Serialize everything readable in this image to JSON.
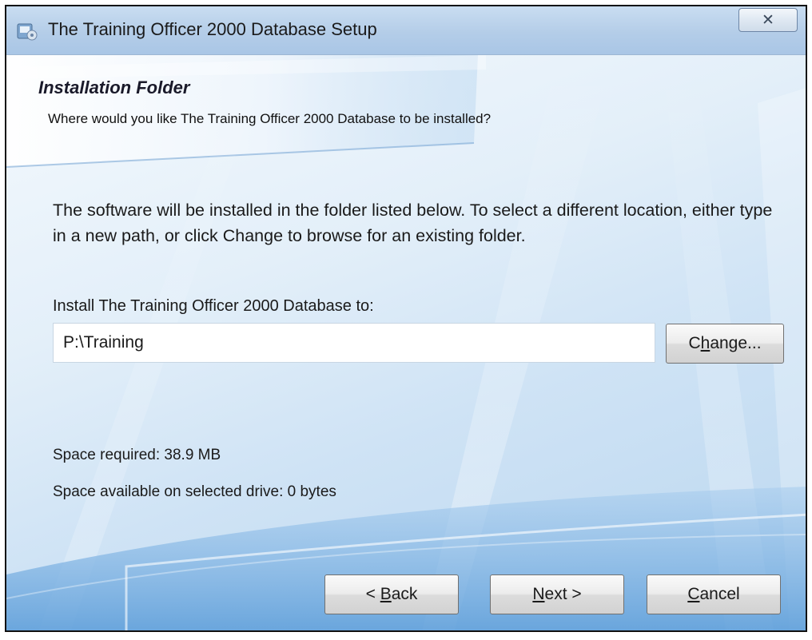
{
  "window": {
    "title": "The Training Officer 2000 Database Setup",
    "close_symbol": "✕",
    "title_icon": "setup-installer-icon",
    "close_icon": "close-icon"
  },
  "header": {
    "title": "Installation Folder",
    "subtitle": "Where would you like The Training Officer 2000 Database to be installed?"
  },
  "body": {
    "description": "The software will be installed in the folder listed below. To select a different location, either type in a new path, or click Change to browse for an existing folder.",
    "install_label": "Install The Training Officer 2000 Database to:",
    "install_path": "P:\\Training",
    "change_button": {
      "before": "C",
      "accel": "h",
      "after": "ange..."
    },
    "space_required": "Space required: 38.9 MB",
    "space_available": "Space available on selected drive: 0 bytes"
  },
  "footer": {
    "back_button": {
      "before": "< ",
      "accel": "B",
      "after": "ack"
    },
    "next_button": {
      "before": "",
      "accel": "N",
      "after": "ext >"
    },
    "cancel_button": {
      "before": "",
      "accel": "C",
      "after": "ancel"
    }
  },
  "colors": {
    "title_bar": "#b4cde8",
    "content_background": "#cfe3f5",
    "button_border": "#707070"
  }
}
